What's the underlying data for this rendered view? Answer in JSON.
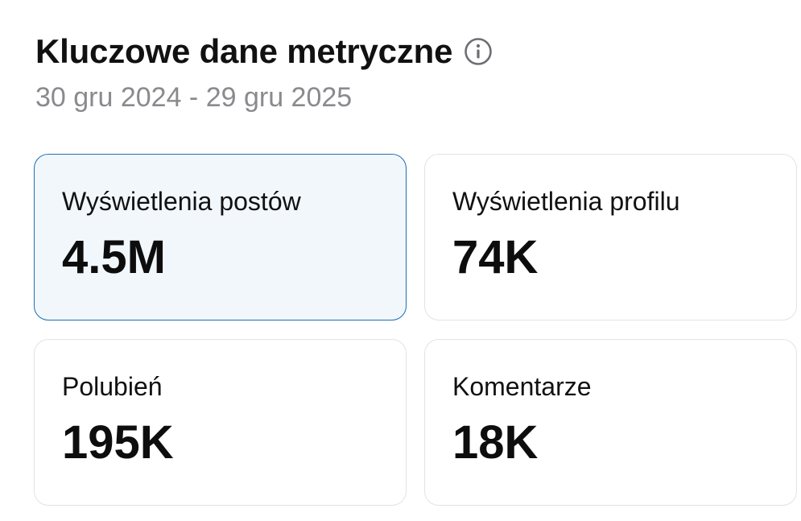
{
  "header": {
    "title": "Kluczowe dane metryczne",
    "info_icon": "info-circle-icon",
    "date_range": "30 gru 2024 - 29 gru 2025"
  },
  "metrics": [
    {
      "label": "Wyświetlenia postów",
      "value": "4.5M",
      "selected": true
    },
    {
      "label": "Wyświetlenia profilu",
      "value": "74K",
      "selected": false
    },
    {
      "label": "Polubień",
      "value": "195K",
      "selected": false
    },
    {
      "label": "Komentarze",
      "value": "18K",
      "selected": false
    }
  ],
  "colors": {
    "selected_border": "#1f6fb2",
    "selected_background": "#f2f7fc",
    "subtitle": "#8a8a8e"
  }
}
